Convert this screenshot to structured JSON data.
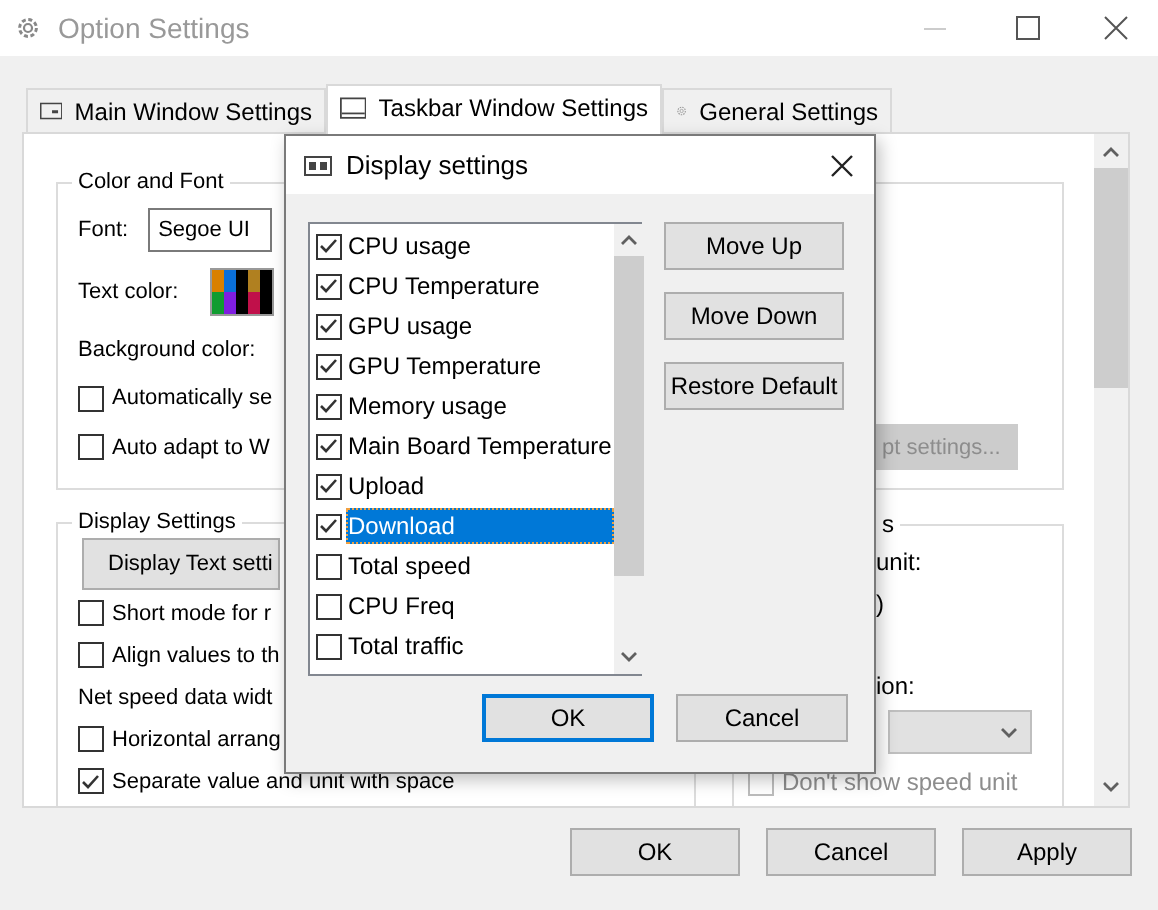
{
  "window": {
    "title": "Option Settings"
  },
  "tabs": [
    {
      "label": "Main Window Settings",
      "selected": false,
      "kind": "window"
    },
    {
      "label": "Taskbar Window Settings",
      "selected": true,
      "kind": "taskbar"
    },
    {
      "label": "General Settings",
      "selected": false,
      "kind": "gear"
    }
  ],
  "color_and_font": {
    "title": "Color and Font",
    "font_label": "Font:",
    "font_value": "Segoe UI",
    "text_color_label": "Text color:",
    "swatch": [
      {
        "color": "#d98000"
      },
      {
        "color": "#0a6fd8"
      },
      {
        "color": "#000000"
      },
      {
        "color": "#b08020"
      },
      {
        "color": "#000000"
      },
      {
        "color": "#109c30"
      },
      {
        "color": "#7f1ee0"
      },
      {
        "color": "#000000"
      },
      {
        "color": "#c0104a"
      },
      {
        "color": "#000000"
      }
    ],
    "background_color_label": "Background color:",
    "checkboxes": [
      {
        "label": "Automatically se",
        "checked": false
      },
      {
        "label": "Auto adapt to W",
        "checked": false
      }
    ],
    "button": {
      "label": "pt settings...",
      "disabled": true
    }
  },
  "display_settings": {
    "title": "Display Settings",
    "button": "Display Text setti",
    "items": [
      {
        "kind": "checkbox",
        "label": "Short mode for r",
        "checked": false
      },
      {
        "kind": "checkbox",
        "label": "Align values to th",
        "checked": false
      },
      {
        "kind": "label",
        "label": "Net speed data widt"
      },
      {
        "kind": "checkbox",
        "label": "Horizontal arrang",
        "checked": false
      },
      {
        "kind": "checkbox",
        "label": "Separate value and unit with space",
        "checked": true
      }
    ]
  },
  "unit_group": {
    "title": "s",
    "texts": [
      "unit:",
      ")",
      "ion:"
    ],
    "dropdown": {
      "disabled": true
    },
    "checkbox": {
      "label": "Don't show speed unit",
      "checked": false,
      "disabled": true
    }
  },
  "dialog": {
    "title": "Display settings",
    "items": [
      {
        "label": "CPU usage",
        "checked": true,
        "selected": false
      },
      {
        "label": "CPU Temperature",
        "checked": true,
        "selected": false
      },
      {
        "label": "GPU usage",
        "checked": true,
        "selected": false
      },
      {
        "label": "GPU Temperature",
        "checked": true,
        "selected": false
      },
      {
        "label": "Memory usage",
        "checked": true,
        "selected": false
      },
      {
        "label": "Main Board Temperature",
        "checked": true,
        "selected": false
      },
      {
        "label": "Upload",
        "checked": true,
        "selected": false
      },
      {
        "label": "Download",
        "checked": true,
        "selected": true
      },
      {
        "label": "Total speed",
        "checked": false,
        "selected": false
      },
      {
        "label": "CPU Freq",
        "checked": false,
        "selected": false
      },
      {
        "label": "Total traffic",
        "checked": false,
        "selected": false
      }
    ],
    "side_buttons": [
      "Move Up",
      "Move Down",
      "Restore Default"
    ],
    "ok": "OK",
    "cancel": "Cancel"
  },
  "footer_buttons": [
    "OK",
    "Cancel",
    "Apply"
  ]
}
